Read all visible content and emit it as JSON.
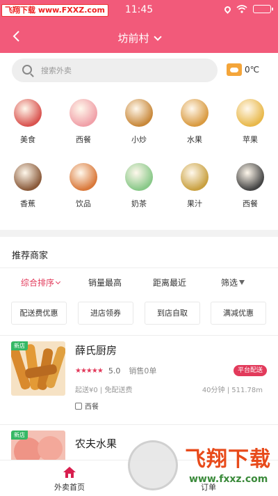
{
  "status": {
    "watermark": "飞翔下载 www.FXXZ.com",
    "time": "11:45"
  },
  "header": {
    "location": "坊前村"
  },
  "search": {
    "placeholder": "搜索外卖",
    "temperature": "0℃"
  },
  "categories": [
    {
      "label": "美食",
      "icon": "food-basket-icon",
      "color": "#d9534f"
    },
    {
      "label": "西餐",
      "icon": "cupcake-icon",
      "color": "#f0a0a8"
    },
    {
      "label": "小炒",
      "icon": "stir-fry-icon",
      "color": "#c8883a"
    },
    {
      "label": "水果",
      "icon": "burger-icon",
      "color": "#d99a40"
    },
    {
      "label": "苹果",
      "icon": "sandwich-icon",
      "color": "#e8b84a"
    },
    {
      "label": "香蕉",
      "icon": "pot-icon",
      "color": "#8a5a3a"
    },
    {
      "label": "饮品",
      "icon": "drink-icon",
      "color": "#d9783a"
    },
    {
      "label": "奶茶",
      "icon": "noodle-bowl-icon",
      "color": "#88c888"
    },
    {
      "label": "果汁",
      "icon": "fruit-basket-icon",
      "color": "#c8a040"
    },
    {
      "label": "西餐",
      "icon": "frying-pan-icon",
      "color": "#444444"
    }
  ],
  "recommend": {
    "title": "推荐商家",
    "sort": [
      "综合排序",
      "销量最高",
      "距离最近",
      "筛选"
    ],
    "chips": [
      "配送费优惠",
      "进店领券",
      "到店自取",
      "满减优惠"
    ],
    "stores": [
      {
        "badge": "新店",
        "name": "薛氏厨房",
        "stars": "★★★★★",
        "score": "5.0",
        "sales": "销售0单",
        "platform": "平台配送",
        "fee": "起送¥0 | 免配送费",
        "eta": "40分钟 | 511.78m",
        "tag": "西餐"
      },
      {
        "badge": "新店",
        "name": "农夫水果"
      }
    ]
  },
  "nav": {
    "home": "外卖首页",
    "orders": "订单"
  },
  "watermark": {
    "brand": "飞翔下载",
    "url": "www.fxxz.com"
  }
}
